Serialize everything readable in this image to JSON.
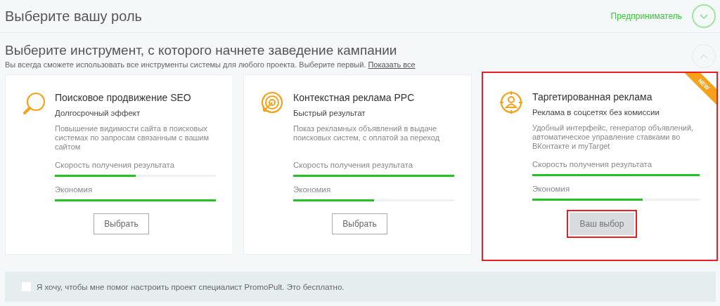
{
  "role_section": {
    "title": "Выберите вашу роль",
    "value": "Предприниматель",
    "expanded": false
  },
  "tool_section": {
    "title": "Выберите инструмент, с которого начнете заведение кампании",
    "expanded": true,
    "hint": "Вы всегда сможете использовать все инструменты системы для любого проекта. Выберите первый.",
    "link": "Показать все"
  },
  "cards": [
    {
      "kind": "search",
      "title": "Поисковое продвижение SEO",
      "subtitle": "Долгосрочный эффект",
      "description": "Повышение видимости сайта в поисковых системах по запросам связанным с вашим сайтом",
      "meters": [
        {
          "label": "Скорость получения результата",
          "level": 0.5
        },
        {
          "label": "Экономия",
          "level": 1.0
        }
      ],
      "button": "Выбрать",
      "selected": false
    },
    {
      "kind": "target",
      "title": "Контекстная реклама PPC",
      "subtitle": "Быстрый результат",
      "description": "Показ рекламных объявлений в выдаче поисковых систем, с оплатой за переход",
      "meters": [
        {
          "label": "Скорость получения результата",
          "level": 1.0
        },
        {
          "label": "Экономия",
          "level": 0.5
        }
      ],
      "button": "Выбрать",
      "selected": false
    },
    {
      "kind": "person",
      "title": "Таргетированная реклама",
      "subtitle": "Реклама в соцсетях без комиссии",
      "description": "Удобный интерфейс, генератор объявлений, автоматическое управление ставками во ВКонтакте и myTarget",
      "meters": [
        {
          "label": "Скорость получения результата",
          "level": 1.0
        },
        {
          "label": "Экономия",
          "level": 0.66
        }
      ],
      "button": "Ваш выбор",
      "selected": true,
      "badge": "NEW"
    }
  ],
  "help_option": {
    "label": "Я хочу, чтобы мне помог настроить проект специалист PromoPult. Это бесплатно.",
    "checked": false
  }
}
